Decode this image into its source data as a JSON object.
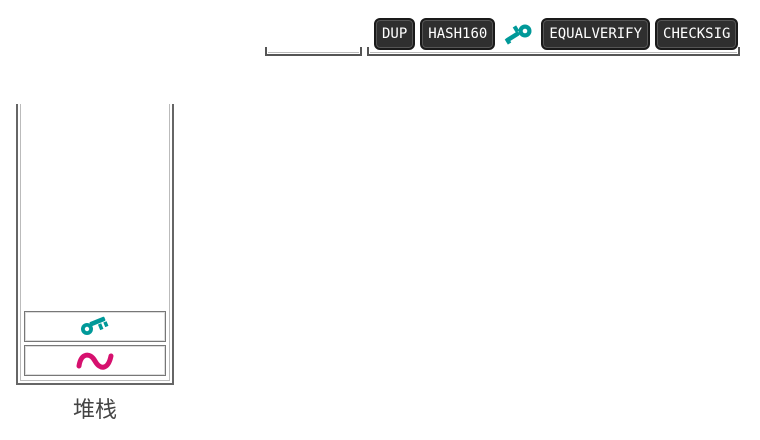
{
  "script": {
    "opcodes": [
      "DUP",
      "HASH160",
      "EQUALVERIFY",
      "CHECKSIG"
    ],
    "hash_icon": "teal-key-hash-icon"
  },
  "stack": {
    "label": "堆栈",
    "items": [
      {
        "icon": "key-icon",
        "color": "#009999"
      },
      {
        "icon": "signature-icon",
        "color": "#d6106e"
      }
    ]
  },
  "colors": {
    "opcode_bg": "#2f2f2f",
    "opcode_text": "#ffffff",
    "key_teal": "#009999",
    "signature_pink": "#d6106e",
    "outline": "#666666"
  }
}
